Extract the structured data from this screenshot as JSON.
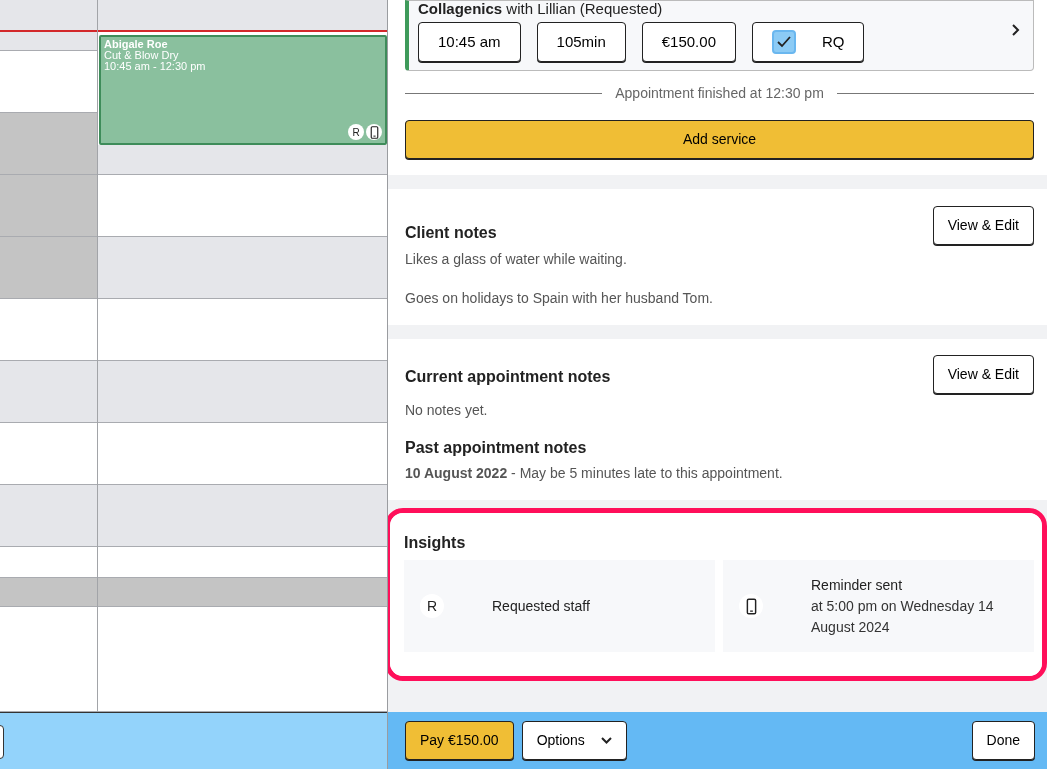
{
  "calendar": {
    "columns": [
      {
        "slots": [
          {
            "open": false,
            "blocked": false
          },
          {
            "open": false,
            "blocked": false
          },
          {
            "open": true,
            "blocked": false
          },
          {
            "open": false,
            "blocked": true
          },
          {
            "open": false,
            "blocked": true
          },
          {
            "open": false,
            "blocked": true
          },
          {
            "open": true,
            "blocked": false
          },
          {
            "open": false,
            "blocked": false
          },
          {
            "open": true,
            "blocked": false
          },
          {
            "open": false,
            "blocked": false
          },
          {
            "open": true,
            "blocked": false
          },
          {
            "open": false,
            "blocked": true
          },
          {
            "open": true,
            "blocked": false
          }
        ]
      },
      {
        "slots": [
          {
            "open": false,
            "blocked": false
          },
          {
            "open": false,
            "blocked": false
          },
          {
            "open": true,
            "blocked": false
          },
          {
            "open": false,
            "blocked": false
          },
          {
            "open": true,
            "blocked": false
          },
          {
            "open": false,
            "blocked": false
          },
          {
            "open": true,
            "blocked": false
          },
          {
            "open": false,
            "blocked": false
          },
          {
            "open": true,
            "blocked": false
          },
          {
            "open": false,
            "blocked": true
          },
          {
            "open": true,
            "blocked": false
          }
        ]
      }
    ],
    "appointment": {
      "client": "Abigale Roe",
      "service": "Cut & Blow Dry",
      "time": "10:45 am - 12:30 pm",
      "color": "#8ac09e",
      "badges": [
        {
          "kind": "text",
          "label": "R"
        },
        {
          "kind": "phone"
        }
      ]
    }
  },
  "service_card": {
    "title": "Collagenics",
    "staff": "with Lillian (Requested)",
    "fields": [
      {
        "kind": "text",
        "value": "10:45 am"
      },
      {
        "kind": "text",
        "value": "105min"
      },
      {
        "kind": "text",
        "value": "€150.00"
      },
      {
        "kind": "check",
        "label": "RQ",
        "checked": true
      }
    ]
  },
  "finished_note": "Appointment finished at 12:30 pm",
  "add_service": "Add service",
  "client_notes": {
    "title": "Client notes",
    "button": "View & Edit",
    "notes": [
      "Likes a glass of water while waiting.",
      "Goes on holidays to Spain with her husband Tom."
    ]
  },
  "appointment_notes": {
    "title": "Current appointment notes",
    "button": "View & Edit",
    "empty": "No notes yet.",
    "past_title": "Past appointment notes",
    "past": [
      "**10 August 2022** - May be 5 minutes late to this appointment."
    ]
  },
  "insights": {
    "title": "Insights",
    "highlighted": true,
    "items": [
      {
        "kind": "text",
        "icon": "R",
        "lines": [
          "Requested staff"
        ]
      },
      {
        "kind": "phone",
        "lines": [
          "Reminder sent",
          "at 5:00 pm on Wednesday 14 August 2024"
        ]
      }
    ]
  },
  "footer": {
    "pay": "Pay €150.00",
    "options": "Options",
    "done": "Done"
  }
}
